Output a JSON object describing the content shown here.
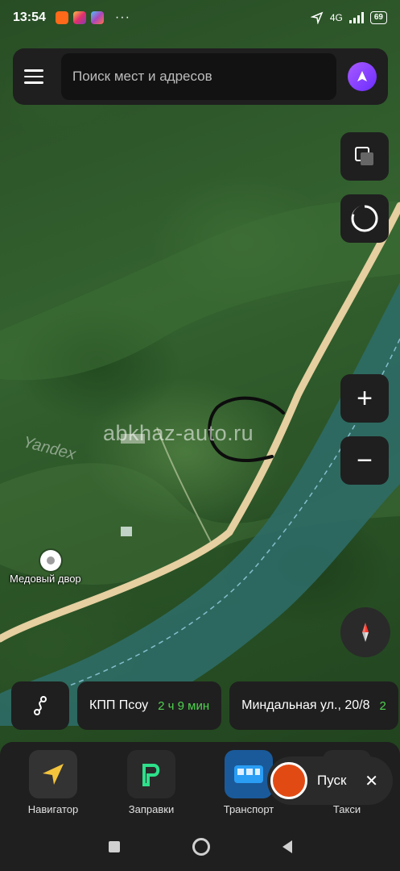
{
  "status_bar": {
    "time": "13:54",
    "network": "4G",
    "battery": "69",
    "more": "···"
  },
  "search": {
    "placeholder": "Поиск мест и адресов"
  },
  "map": {
    "watermark": "abkhaz-auto.ru",
    "yandex_logo": "Yandex",
    "poi_label": "Медовый двор",
    "colors": {
      "road": "#e6cfa0",
      "river": "#2e6f6a",
      "forest": "#2f5a2a"
    }
  },
  "controls": {
    "layers_icon": "layers-icon",
    "alice_icon": "alice-icon",
    "zoom_in": "+",
    "zoom_out": "−",
    "compass_icon": "compass-icon"
  },
  "routes": [
    {
      "name": "КПП Псоу",
      "time": "2 ч 9 мин"
    },
    {
      "name": "Миндальная ул., 20/8",
      "time": "2"
    }
  ],
  "shortcuts": [
    {
      "label": "Навигатор",
      "icon": "navigator-icon",
      "color": "#f4c43c"
    },
    {
      "label": "Заправки",
      "icon": "fuel-icon",
      "color": "#2de08a"
    },
    {
      "label": "Транспорт",
      "icon": "transport-icon",
      "color": "#2a9df4"
    },
    {
      "label": "Такси",
      "icon": "taxi-icon",
      "color": "#ffcc00"
    }
  ],
  "pusk": {
    "label": "Пуск",
    "close": "✕"
  }
}
